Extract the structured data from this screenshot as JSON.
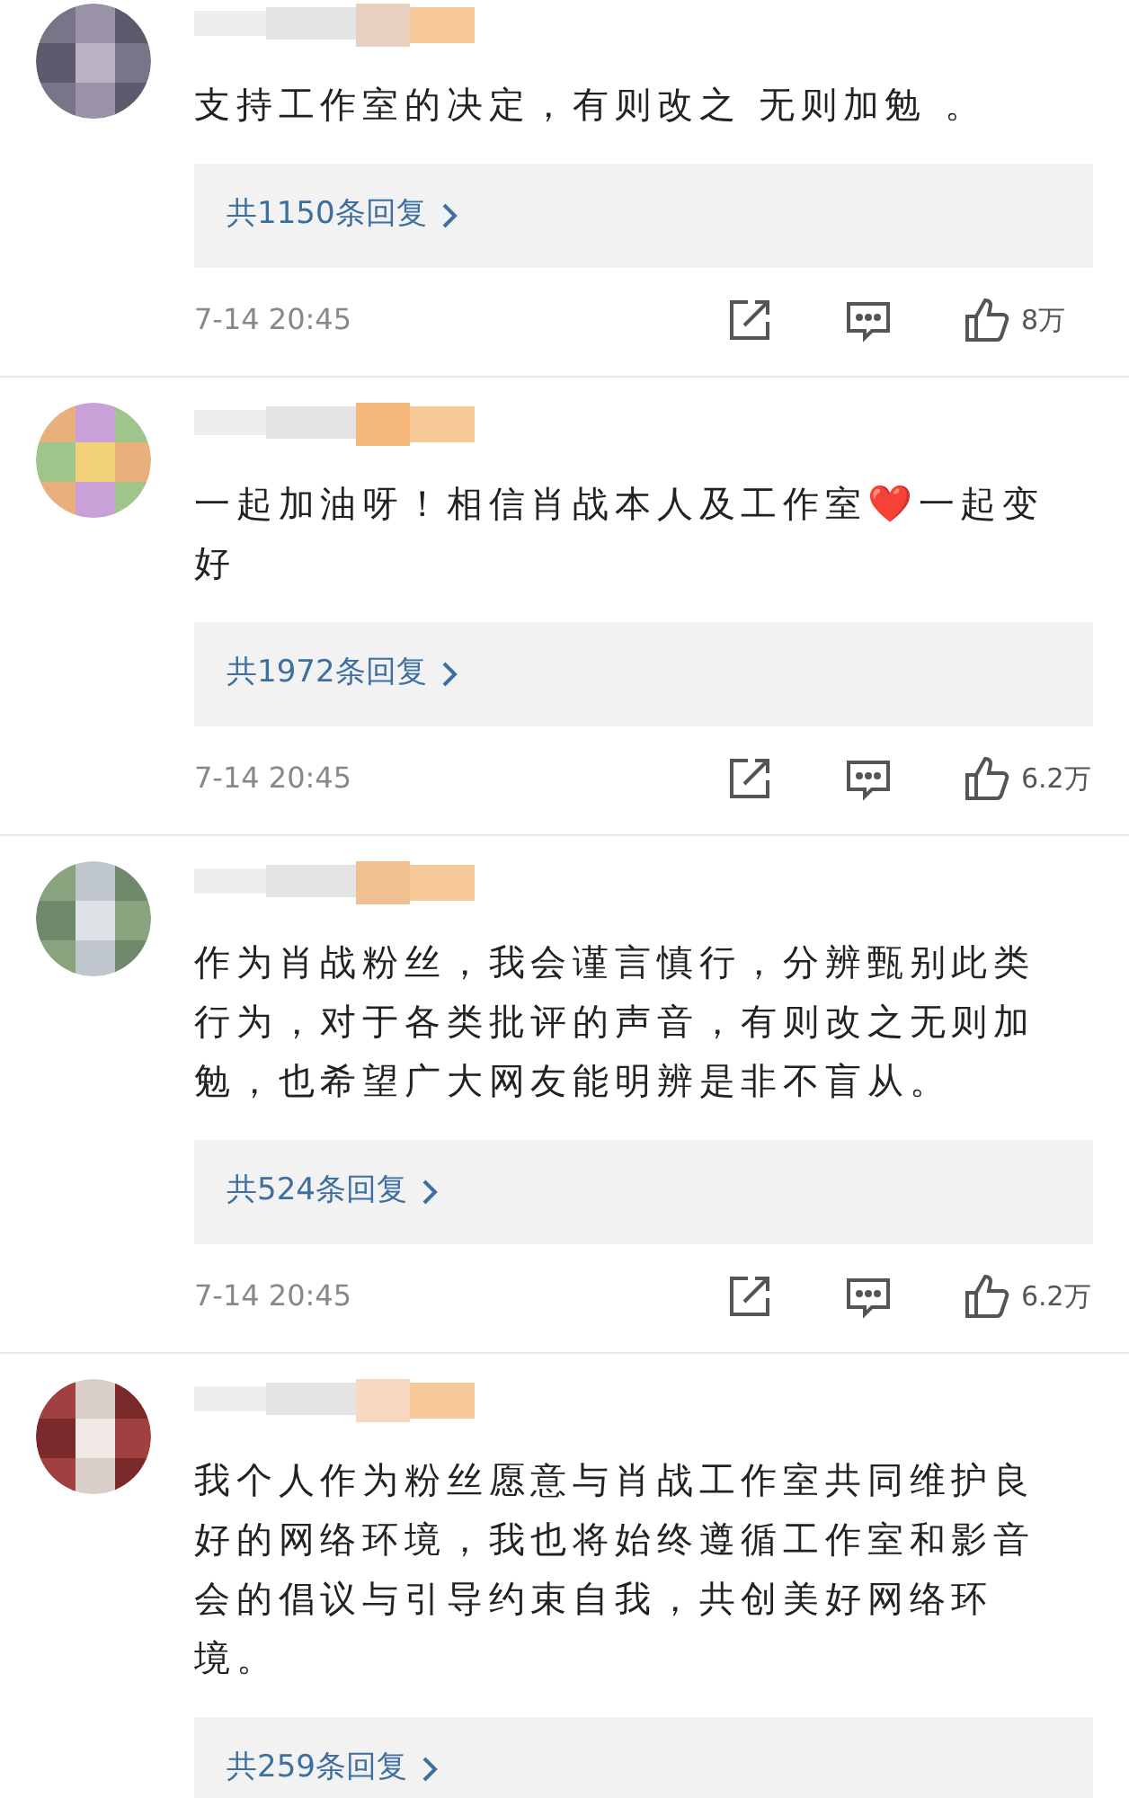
{
  "comments": [
    {
      "text": "支持工作室的决定，有则改之 无则加勉 。",
      "replies": "共1150条回复",
      "time": "7-14 20:45",
      "likes": "8万"
    },
    {
      "text": "一起加油呀！相信肖战本人及工作室❤️一起变好",
      "replies": "共1972条回复",
      "time": "7-14 20:45",
      "likes": "6.2万"
    },
    {
      "text": "作为肖战粉丝，我会谨言慎行，分辨甄别此类行为，对于各类批评的声音，有则改之无则加勉，也希望广大网友能明辨是非不盲从。",
      "replies": "共524条回复",
      "time": "7-14 20:45",
      "likes": "6.2万"
    },
    {
      "text": "我个人作为粉丝愿意与肖战工作室共同维护良好的网络环境，我也将始终遵循工作室和影音会的倡议与引导约束自我，共创美好网络环境。",
      "replies": "共259条回复"
    }
  ]
}
